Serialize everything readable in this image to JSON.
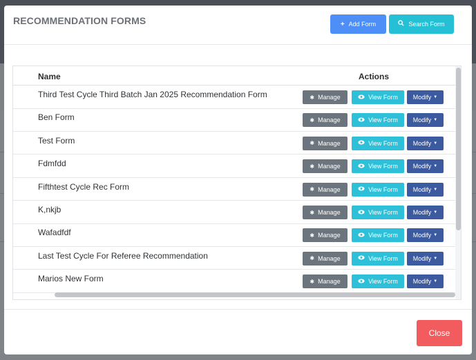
{
  "modal": {
    "title": "RECOMMENDATION FORMS",
    "add_form_label": "Add Form",
    "search_form_label": "Search Form"
  },
  "table": {
    "headers": {
      "name": "Name",
      "actions": "Actions"
    },
    "rows": [
      {
        "name": "Third Test Cycle Third Batch Jan 2025 Recommendation Form"
      },
      {
        "name": "Ben Form"
      },
      {
        "name": "Test Form"
      },
      {
        "name": "Fdmfdd"
      },
      {
        "name": "Fifthtest Cycle Rec Form"
      },
      {
        "name": "K,nkjb"
      },
      {
        "name": "Wafadfdf"
      },
      {
        "name": "Last Test Cycle For Referee Recommendation"
      },
      {
        "name": "Marios New Form"
      }
    ],
    "action_labels": {
      "manage": "Manage",
      "view": "View Form",
      "modify": "Modify"
    }
  },
  "footer": {
    "close_label": "Close"
  },
  "colors": {
    "add": "#4e8ef7",
    "search": "#26c0d6",
    "manage": "#6c757d",
    "view": "#2ec0d9",
    "modify": "#3b5aa0",
    "close": "#f25c5f"
  },
  "icons": {
    "add": "plus-icon",
    "search": "search-icon",
    "manage": "gear-icon",
    "view": "eye-icon",
    "modify": "caret-down-icon"
  }
}
